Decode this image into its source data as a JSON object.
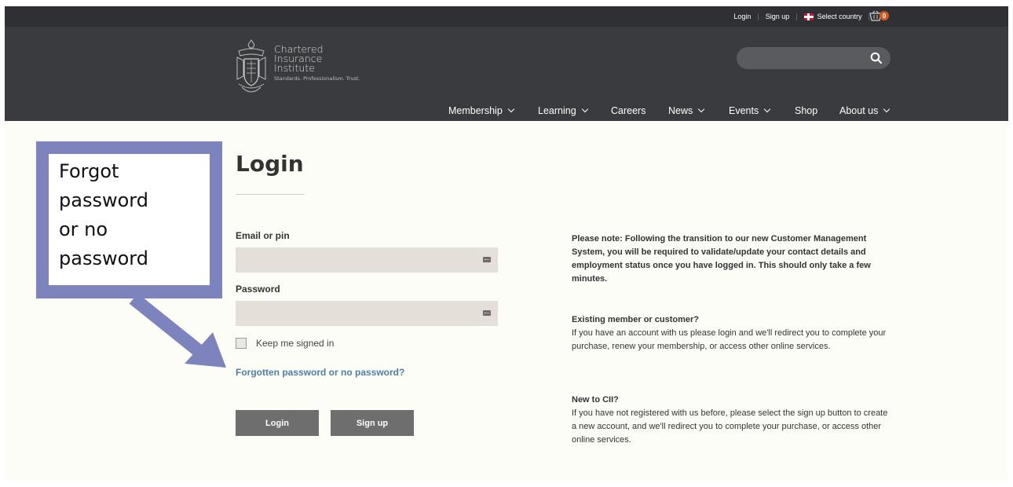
{
  "topbar": {
    "login": "Login",
    "signup": "Sign up",
    "select_country": "Select country",
    "cart_count": "0"
  },
  "logo": {
    "line1": "Chartered",
    "line2": "Insurance",
    "line3": "Institute",
    "tagline": "Standards. Professionalism. Trust."
  },
  "search": {
    "placeholder": ""
  },
  "nav": {
    "membership": "Membership",
    "learning": "Learning",
    "careers": "Careers",
    "news": "News",
    "events": "Events",
    "shop": "Shop",
    "about": "About us"
  },
  "main": {
    "title": "Login",
    "email_label": "Email or pin",
    "password_label": "Password",
    "keep_signed_in": "Keep me signed in",
    "forgot_link": "Forgotten password or no password?",
    "login_button": "Login",
    "signup_button": "Sign up"
  },
  "info": {
    "note": "Please note: Following the transition to our new Customer Management System, you will be required to validate/update your contact details and employment status once you have logged in. This should only take a few minutes.",
    "existing_heading": "Existing member or customer?",
    "existing_text": "If you have an account with us please login and we'll redirect you to complete your purchase, renew your membership, or access other online services.",
    "new_heading": "New to CII?",
    "new_text": "If you have not registered with us before, please select the sign up button to create a new account, and we'll redirect you to complete your purchase, or access other online services."
  },
  "annotation": {
    "line1": "Forgot",
    "line2": "password",
    "line3": "or no",
    "line4": "password",
    "color": "#7d83bd"
  }
}
